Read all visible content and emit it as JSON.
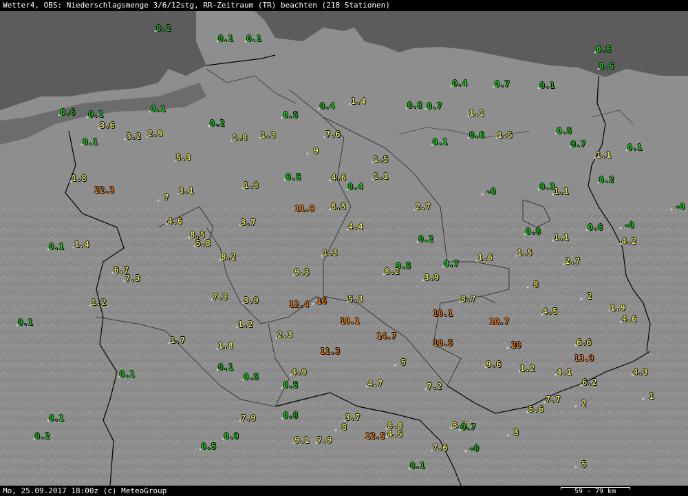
{
  "header": {
    "title": "Wetter4, OBS: Niederschlagsmenge 3/6/12stg, RR-Zeitraum (TR) beachten (218 Stationen)"
  },
  "footer": {
    "text": "Mo, 25.09.2017 18:00z (c) MeteoGroup",
    "scale_label": "59 - 79 km"
  },
  "colors": {
    "low": "#22cc22",
    "mid": "#e8e85a",
    "high": "#e67e1e",
    "land": "#8e8e8e",
    "sea": "#5c5c5c",
    "border": "#000000"
  },
  "observations": [
    {
      "value": "0.2",
      "lon": 8.5,
      "lat": 55.1
    },
    {
      "value": "0.1",
      "lon": 9.6,
      "lat": 54.98
    },
    {
      "value": "0.1",
      "lon": 10.1,
      "lat": 54.98
    },
    {
      "value": "0.4",
      "lon": 13.75,
      "lat": 54.45
    },
    {
      "value": "0.7",
      "lon": 14.5,
      "lat": 54.44
    },
    {
      "value": "0.1",
      "lon": 15.3,
      "lat": 54.43
    },
    {
      "value": "0.5",
      "lon": 16.3,
      "lat": 54.85
    },
    {
      "value": "0.6",
      "lon": 6.8,
      "lat": 54.11
    },
    {
      "value": "0.1",
      "lon": 7.3,
      "lat": 54.09
    },
    {
      "value": "0.1",
      "lon": 8.4,
      "lat": 54.15
    },
    {
      "value": "3.6",
      "lon": 7.5,
      "lat": 53.96
    },
    {
      "value": "3.2",
      "lon": 7.97,
      "lat": 53.83
    },
    {
      "value": "2.9",
      "lon": 8.35,
      "lat": 53.86
    },
    {
      "value": "0.1",
      "lon": 7.2,
      "lat": 53.76
    },
    {
      "value": "0.2",
      "lon": 9.45,
      "lat": 53.98
    },
    {
      "value": "0.5",
      "lon": 10.75,
      "lat": 54.08
    },
    {
      "value": "0.4",
      "lon": 11.4,
      "lat": 54.18
    },
    {
      "value": "1.4",
      "lon": 11.95,
      "lat": 54.24
    },
    {
      "value": "0.8",
      "lon": 12.95,
      "lat": 54.19
    },
    {
      "value": "0.7",
      "lon": 13.3,
      "lat": 54.18
    },
    {
      "value": "1.1",
      "lon": 14.05,
      "lat": 54.1
    },
    {
      "value": "1.8",
      "lon": 9.85,
      "lat": 53.81
    },
    {
      "value": "1.3",
      "lon": 10.35,
      "lat": 53.84
    },
    {
      "value": "7.6",
      "lon": 11.5,
      "lat": 53.85
    },
    {
      "value": "9",
      "lon": 11.2,
      "lat": 53.66
    },
    {
      "value": "0.1",
      "lon": 13.4,
      "lat": 53.76
    },
    {
      "value": "0.6",
      "lon": 14.05,
      "lat": 53.84
    },
    {
      "value": "1.5",
      "lon": 14.55,
      "lat": 53.84
    },
    {
      "value": "0.5",
      "lon": 15.6,
      "lat": 53.89
    },
    {
      "value": "0.7",
      "lon": 15.85,
      "lat": 53.74
    },
    {
      "value": "1.1",
      "lon": 16.3,
      "lat": 53.61
    },
    {
      "value": "0.1",
      "lon": 16.85,
      "lat": 53.7
    },
    {
      "value": "0.6",
      "lon": 16.35,
      "lat": 54.65
    },
    {
      "value": "5.3",
      "lon": 8.85,
      "lat": 53.58
    },
    {
      "value": "1.5",
      "lon": 12.35,
      "lat": 53.56
    },
    {
      "value": "1.1",
      "lon": 12.35,
      "lat": 53.36
    },
    {
      "value": "1.8",
      "lon": 7.0,
      "lat": 53.33
    },
    {
      "value": "22.3",
      "lon": 7.45,
      "lat": 53.2
    },
    {
      "value": "3.1",
      "lon": 8.9,
      "lat": 53.19
    },
    {
      "value": "7",
      "lon": 8.55,
      "lat": 53.11
    },
    {
      "value": "1.8",
      "lon": 10.05,
      "lat": 53.25
    },
    {
      "value": "0.5",
      "lon": 10.8,
      "lat": 53.35
    },
    {
      "value": "4.6",
      "lon": 11.6,
      "lat": 53.34
    },
    {
      "value": "0.4",
      "lon": 11.9,
      "lat": 53.24
    },
    {
      "value": "0.2",
      "lon": 16.35,
      "lat": 53.32
    },
    {
      "value": "0.3",
      "lon": 15.3,
      "lat": 53.24
    },
    {
      "value": "1.1",
      "lon": 15.55,
      "lat": 53.18
    },
    {
      "value": "-0",
      "lon": 14.3,
      "lat": 53.18
    },
    {
      "value": "11.9",
      "lon": 11.0,
      "lat": 52.98
    },
    {
      "value": "8.5",
      "lon": 11.6,
      "lat": 53.0
    },
    {
      "value": "2.7",
      "lon": 13.1,
      "lat": 53.0
    },
    {
      "value": "-0",
      "lon": 18.0,
      "lat": 53.0
    },
    {
      "value": "4.6",
      "lon": 8.7,
      "lat": 52.83
    },
    {
      "value": "3.7",
      "lon": 10.0,
      "lat": 52.82
    },
    {
      "value": "4.4",
      "lon": 11.9,
      "lat": 52.77
    },
    {
      "value": "-0",
      "lon": 16.75,
      "lat": 52.78
    },
    {
      "value": "0.6",
      "lon": 16.15,
      "lat": 52.76
    },
    {
      "value": "0.8",
      "lon": 15.05,
      "lat": 52.71
    },
    {
      "value": "1.1",
      "lon": 15.55,
      "lat": 52.64
    },
    {
      "value": "4.2",
      "lon": 16.75,
      "lat": 52.6
    },
    {
      "value": "8.5",
      "lon": 9.1,
      "lat": 52.67
    },
    {
      "value": "5.8",
      "lon": 9.2,
      "lat": 52.57
    },
    {
      "value": "0.2",
      "lon": 13.15,
      "lat": 52.62
    },
    {
      "value": "0.1",
      "lon": 6.6,
      "lat": 52.53
    },
    {
      "value": "1.4",
      "lon": 7.05,
      "lat": 52.56
    },
    {
      "value": "1.3",
      "lon": 11.45,
      "lat": 52.46
    },
    {
      "value": "8.2",
      "lon": 9.65,
      "lat": 52.41
    },
    {
      "value": "1.6",
      "lon": 14.2,
      "lat": 52.4
    },
    {
      "value": "1.5",
      "lon": 14.9,
      "lat": 52.46
    },
    {
      "value": "0.7",
      "lon": 13.6,
      "lat": 52.33
    },
    {
      "value": "2.7",
      "lon": 15.75,
      "lat": 52.36
    },
    {
      "value": "0.5",
      "lon": 12.75,
      "lat": 52.31
    },
    {
      "value": "6.7",
      "lon": 7.75,
      "lat": 52.26
    },
    {
      "value": "8.2",
      "lon": 12.55,
      "lat": 52.24
    },
    {
      "value": "9.3",
      "lon": 10.95,
      "lat": 52.23
    },
    {
      "value": "3.9",
      "lon": 13.25,
      "lat": 52.17
    },
    {
      "value": "7.3",
      "lon": 7.95,
      "lat": 52.16
    },
    {
      "value": "8",
      "lon": 15.1,
      "lat": 52.09
    },
    {
      "value": "7.3",
      "lon": 9.5,
      "lat": 51.94
    },
    {
      "value": "3.9",
      "lon": 10.05,
      "lat": 51.9
    },
    {
      "value": "12.4",
      "lon": 10.9,
      "lat": 51.85
    },
    {
      "value": "16",
      "lon": 11.3,
      "lat": 51.89
    },
    {
      "value": "5.3",
      "lon": 11.9,
      "lat": 51.92
    },
    {
      "value": "8.7",
      "lon": 13.9,
      "lat": 51.92
    },
    {
      "value": "2",
      "lon": 16.05,
      "lat": 51.95
    },
    {
      "value": "1.2",
      "lon": 7.35,
      "lat": 51.88
    },
    {
      "value": "4.5",
      "lon": 15.35,
      "lat": 51.77
    },
    {
      "value": "1.9",
      "lon": 16.55,
      "lat": 51.81
    },
    {
      "value": "10.1",
      "lon": 13.45,
      "lat": 51.75
    },
    {
      "value": "4.6",
      "lon": 16.75,
      "lat": 51.68
    },
    {
      "value": "10.1",
      "lon": 11.8,
      "lat": 51.66
    },
    {
      "value": "10.7",
      "lon": 14.45,
      "lat": 51.65
    },
    {
      "value": "0.1",
      "lon": 6.05,
      "lat": 51.64
    },
    {
      "value": "1.2",
      "lon": 9.95,
      "lat": 51.62
    },
    {
      "value": "2.3",
      "lon": 10.65,
      "lat": 51.5
    },
    {
      "value": "14.7",
      "lon": 12.45,
      "lat": 51.48
    },
    {
      "value": "1.7",
      "lon": 8.75,
      "lat": 51.43
    },
    {
      "value": "1.8",
      "lon": 9.6,
      "lat": 51.37
    },
    {
      "value": "10.5",
      "lon": 13.45,
      "lat": 51.4
    },
    {
      "value": "20",
      "lon": 14.75,
      "lat": 51.38
    },
    {
      "value": "6.6",
      "lon": 15.95,
      "lat": 51.41
    },
    {
      "value": "11.3",
      "lon": 11.45,
      "lat": 51.3
    },
    {
      "value": "13.9",
      "lon": 15.95,
      "lat": 51.22
    },
    {
      "value": "5",
      "lon": 12.75,
      "lat": 51.17
    },
    {
      "value": "9.6",
      "lon": 14.35,
      "lat": 51.15
    },
    {
      "value": "1.2",
      "lon": 14.95,
      "lat": 51.1
    },
    {
      "value": "4.1",
      "lon": 15.6,
      "lat": 51.06
    },
    {
      "value": "4.3",
      "lon": 16.95,
      "lat": 51.06
    },
    {
      "value": "0.1",
      "lon": 9.6,
      "lat": 51.12
    },
    {
      "value": "0.1",
      "lon": 7.85,
      "lat": 51.04
    },
    {
      "value": "4.9",
      "lon": 10.9,
      "lat": 51.06
    },
    {
      "value": "0.5",
      "lon": 10.05,
      "lat": 51.0
    },
    {
      "value": "6.2",
      "lon": 16.05,
      "lat": 50.94
    },
    {
      "value": "4.7",
      "lon": 12.25,
      "lat": 50.92
    },
    {
      "value": "0.5",
      "lon": 10.75,
      "lat": 50.91
    },
    {
      "value": "7.2",
      "lon": 13.3,
      "lat": 50.89
    },
    {
      "value": "1",
      "lon": 17.15,
      "lat": 50.78
    },
    {
      "value": "7.7",
      "lon": 15.4,
      "lat": 50.74
    },
    {
      "value": "2",
      "lon": 15.95,
      "lat": 50.69
    },
    {
      "value": "5.6",
      "lon": 15.1,
      "lat": 50.62
    },
    {
      "value": "0.1",
      "lon": 6.6,
      "lat": 50.52
    },
    {
      "value": "7.9",
      "lon": 10.0,
      "lat": 50.52
    },
    {
      "value": "0.8",
      "lon": 10.75,
      "lat": 50.55
    },
    {
      "value": "3.7",
      "lon": 11.85,
      "lat": 50.53
    },
    {
      "value": "0.2",
      "lon": 6.35,
      "lat": 50.31
    },
    {
      "value": "8",
      "lon": 11.7,
      "lat": 50.41
    },
    {
      "value": "8.8",
      "lon": 12.6,
      "lat": 50.43
    },
    {
      "value": "8.3",
      "lon": 13.75,
      "lat": 50.44
    },
    {
      "value": "0.7",
      "lon": 13.9,
      "lat": 50.41
    },
    {
      "value": "3",
      "lon": 14.75,
      "lat": 50.35
    },
    {
      "value": "4.5",
      "lon": 12.6,
      "lat": 50.33
    },
    {
      "value": "12.5",
      "lon": 12.25,
      "lat": 50.31
    },
    {
      "value": "0.9",
      "lon": 9.7,
      "lat": 50.31
    },
    {
      "value": "9.1",
      "lon": 10.95,
      "lat": 50.26
    },
    {
      "value": "7.9",
      "lon": 11.35,
      "lat": 50.26
    },
    {
      "value": "0.5",
      "lon": 9.3,
      "lat": 50.19
    },
    {
      "value": "7.6",
      "lon": 13.4,
      "lat": 50.17
    },
    {
      "value": "-0",
      "lon": 14.0,
      "lat": 50.16
    },
    {
      "value": "0.1",
      "lon": 13.0,
      "lat": 49.96
    },
    {
      "value": "5",
      "lon": 15.95,
      "lat": 49.98
    }
  ]
}
